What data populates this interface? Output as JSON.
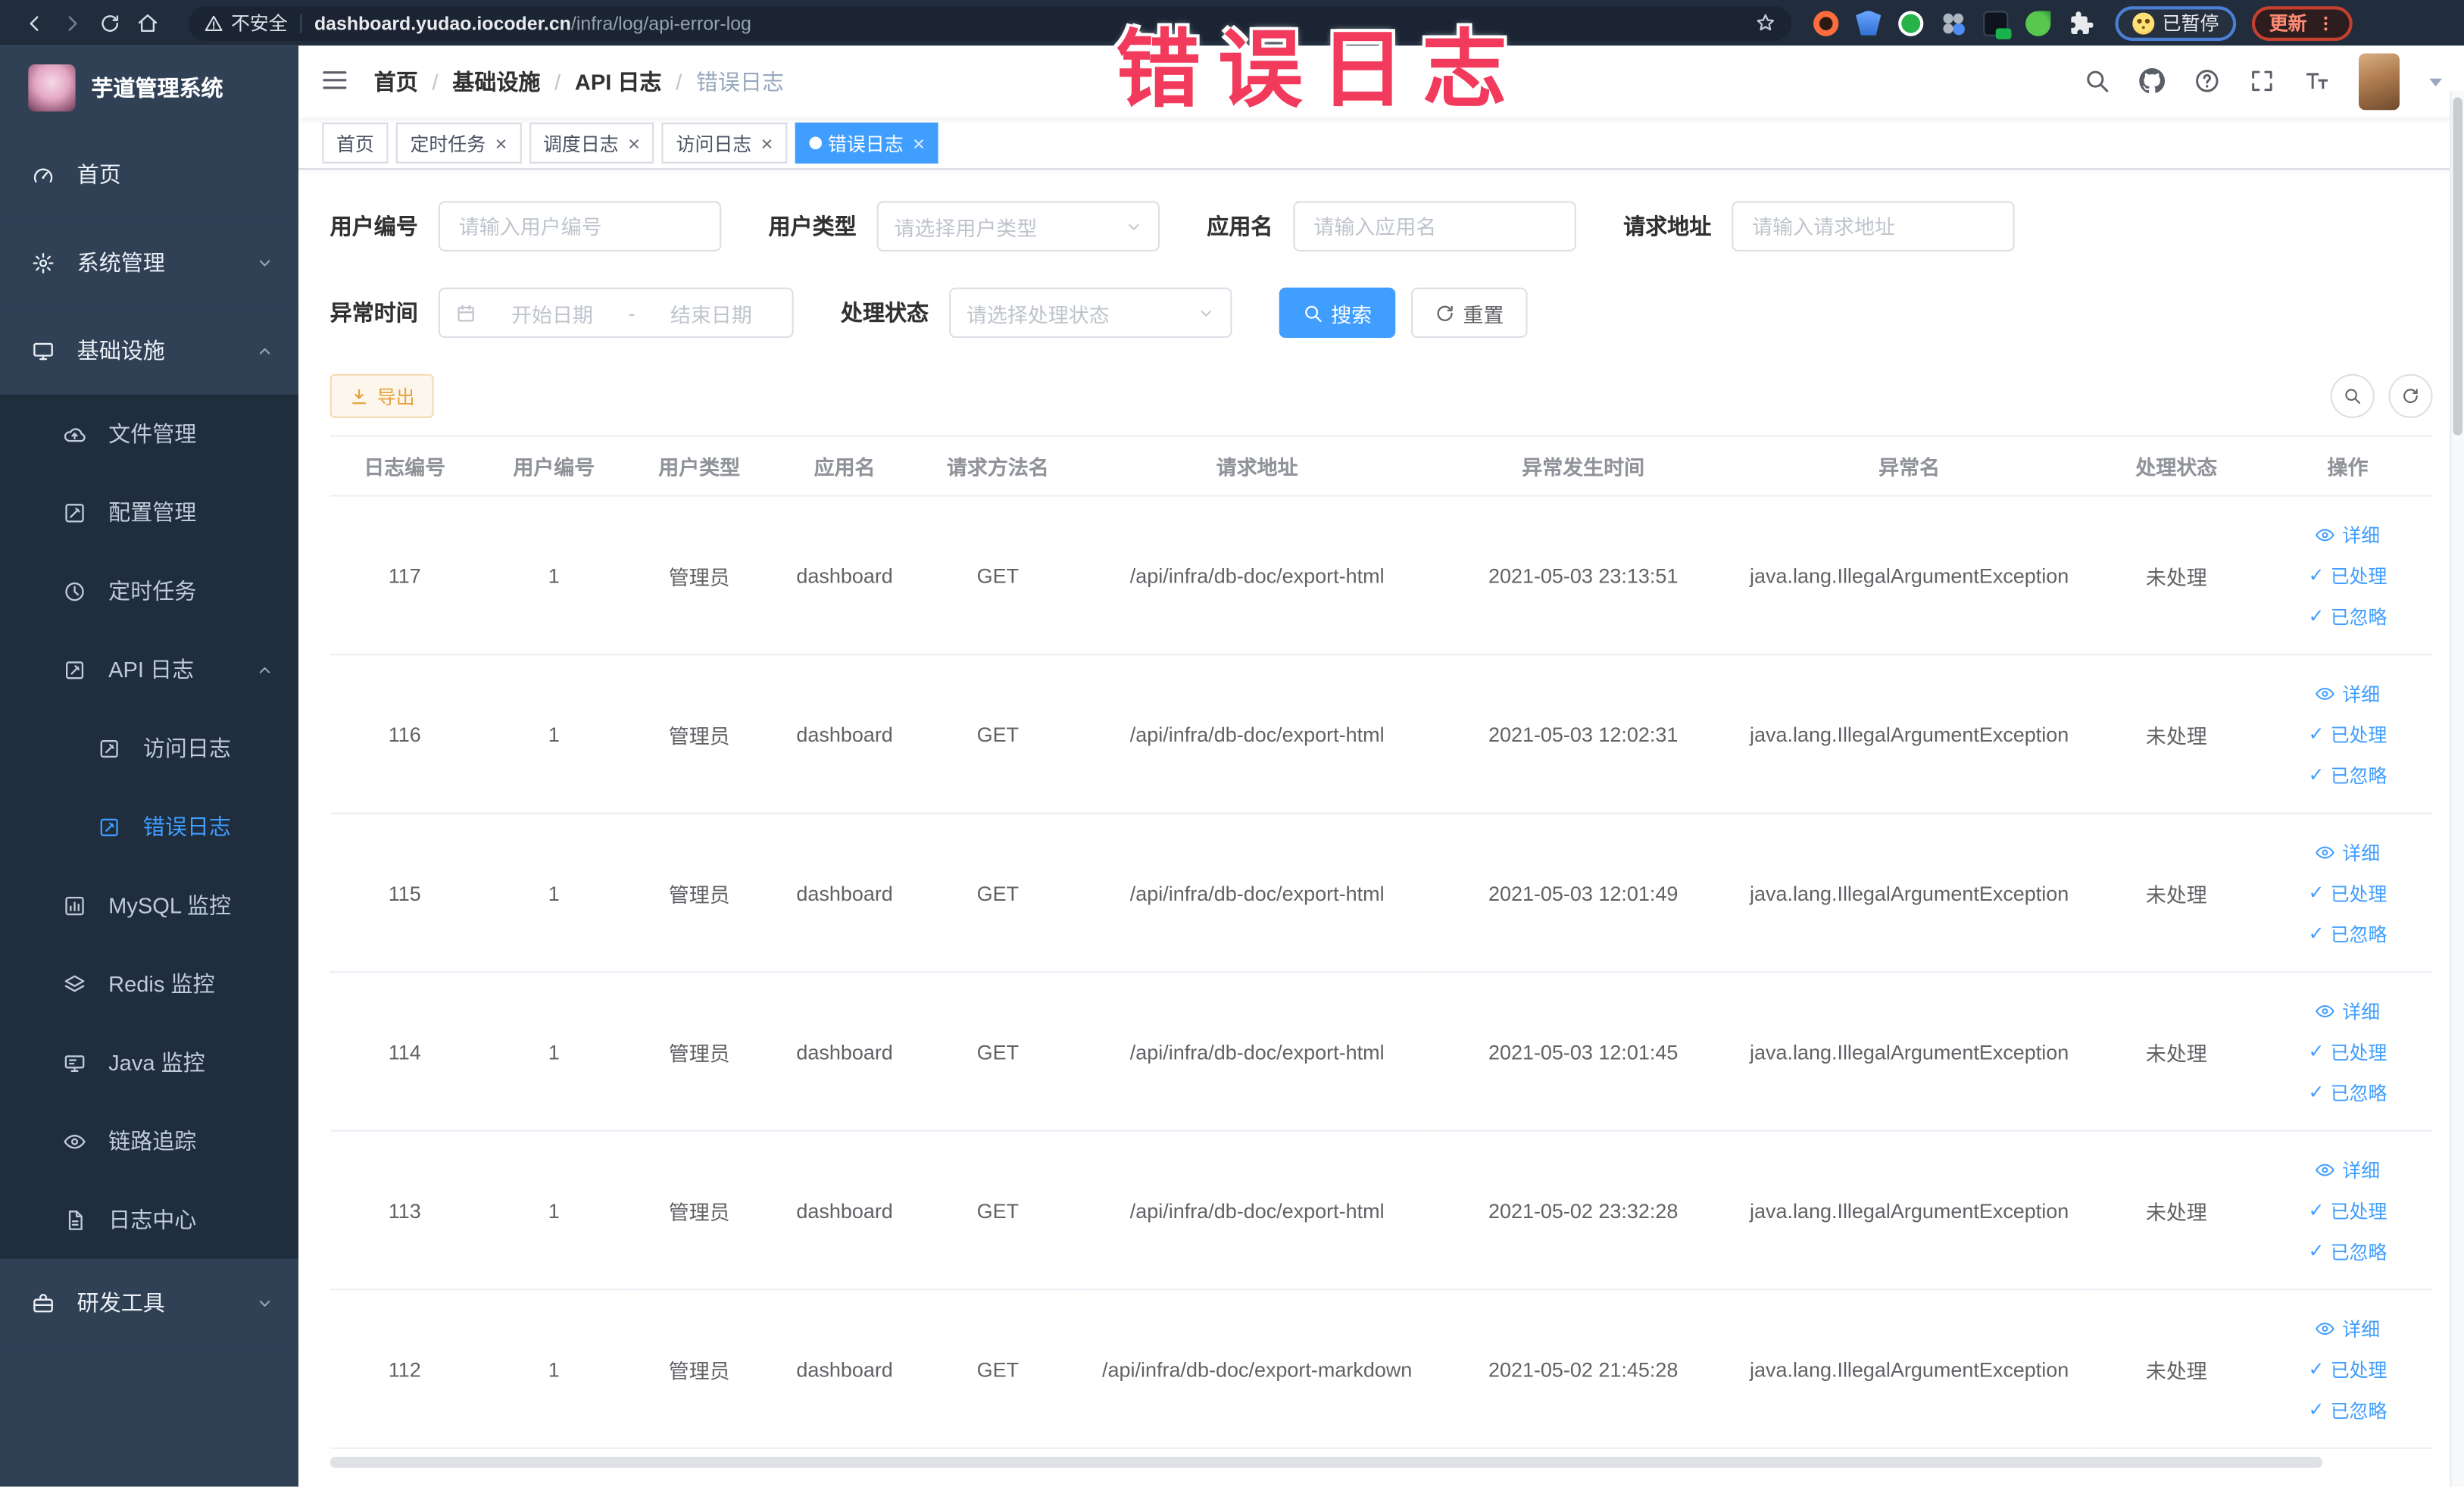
{
  "browser": {
    "security_label": "不安全",
    "url_host": "dashboard.yudao.iocoder.cn",
    "url_path": "/infra/log/api-error-log",
    "paused_label": "已暂停",
    "update_label": "更新"
  },
  "overlay": {
    "title": "错误日志"
  },
  "sidebar": {
    "app_title": "芋道管理系统",
    "items": [
      {
        "name": "home",
        "label": "首页",
        "icon": "gauge",
        "type": "top"
      },
      {
        "name": "system-management",
        "label": "系统管理",
        "icon": "gear",
        "type": "top",
        "arrow": "down"
      },
      {
        "name": "infrastructure",
        "label": "基础设施",
        "icon": "screen",
        "type": "top",
        "arrow": "up"
      },
      {
        "name": "file-management",
        "label": "文件管理",
        "icon": "cloud",
        "type": "sub"
      },
      {
        "name": "config-management",
        "label": "配置管理",
        "icon": "edit",
        "type": "sub"
      },
      {
        "name": "scheduled-tasks",
        "label": "定时任务",
        "icon": "clock",
        "type": "sub"
      },
      {
        "name": "api-log",
        "label": "API 日志",
        "icon": "docedit",
        "type": "sub",
        "arrow": "up"
      },
      {
        "name": "access-log",
        "label": "访问日志",
        "icon": "docedit",
        "type": "sub2"
      },
      {
        "name": "error-log",
        "label": "错误日志",
        "icon": "docedit",
        "type": "sub2",
        "active": true
      },
      {
        "name": "mysql-monitor",
        "label": "MySQL 监控",
        "icon": "chart",
        "type": "sub"
      },
      {
        "name": "redis-monitor",
        "label": "Redis 监控",
        "icon": "layers",
        "type": "sub"
      },
      {
        "name": "java-monitor",
        "label": "Java 监控",
        "icon": "monitor",
        "type": "sub"
      },
      {
        "name": "trace",
        "label": "链路追踪",
        "icon": "eye",
        "type": "sub"
      },
      {
        "name": "log-center",
        "label": "日志中心",
        "icon": "doc",
        "type": "sub"
      },
      {
        "name": "dev-tools",
        "label": "研发工具",
        "icon": "toolbox",
        "type": "top",
        "arrow": "down"
      }
    ]
  },
  "navbar": {
    "breadcrumb": [
      {
        "name": "home",
        "label": "首页"
      },
      {
        "name": "infrastructure",
        "label": "基础设施"
      },
      {
        "name": "api-log",
        "label": "API 日志"
      },
      {
        "name": "error-log",
        "label": "错误日志",
        "current": true
      }
    ]
  },
  "tags": [
    {
      "name": "home",
      "label": "首页"
    },
    {
      "name": "scheduled-tasks",
      "label": "定时任务",
      "closable": true
    },
    {
      "name": "schedule-log",
      "label": "调度日志",
      "closable": true
    },
    {
      "name": "access-log",
      "label": "访问日志",
      "closable": true
    },
    {
      "name": "error-log",
      "label": "错误日志",
      "closable": true,
      "active": true
    }
  ],
  "filters": {
    "user_id": {
      "label": "用户编号",
      "placeholder": "请输入用户编号"
    },
    "user_type": {
      "label": "用户类型",
      "placeholder": "请选择用户类型"
    },
    "app_name": {
      "label": "应用名",
      "placeholder": "请输入应用名"
    },
    "request_url": {
      "label": "请求地址",
      "placeholder": "请输入请求地址"
    },
    "exception_time": {
      "label": "异常时间",
      "start_placeholder": "开始日期",
      "end_placeholder": "结束日期",
      "separator": "-"
    },
    "process_status": {
      "label": "处理状态",
      "placeholder": "请选择处理状态"
    },
    "search_label": "搜索",
    "reset_label": "重置",
    "export_label": "导出"
  },
  "table": {
    "columns": [
      {
        "key": "id",
        "label": "日志编号"
      },
      {
        "key": "user_id",
        "label": "用户编号"
      },
      {
        "key": "user_type",
        "label": "用户类型"
      },
      {
        "key": "app",
        "label": "应用名"
      },
      {
        "key": "method",
        "label": "请求方法名"
      },
      {
        "key": "url",
        "label": "请求地址"
      },
      {
        "key": "time",
        "label": "异常发生时间"
      },
      {
        "key": "exception",
        "label": "异常名"
      },
      {
        "key": "status",
        "label": "处理状态"
      },
      {
        "key": "ops",
        "label": "操作"
      }
    ],
    "actions": [
      {
        "name": "detail",
        "label": "详细",
        "icon": "eye"
      },
      {
        "name": "processed",
        "label": "已处理",
        "icon": "check"
      },
      {
        "name": "ignored",
        "label": "已忽略",
        "icon": "check"
      }
    ],
    "rows": [
      {
        "id": "117",
        "user_id": "1",
        "user_type": "管理员",
        "app": "dashboard",
        "method": "GET",
        "url": "/api/infra/db-doc/export-html",
        "time": "2021-05-03 23:13:51",
        "exception": "java.lang.IllegalArgumentException",
        "status": "未处理"
      },
      {
        "id": "116",
        "user_id": "1",
        "user_type": "管理员",
        "app": "dashboard",
        "method": "GET",
        "url": "/api/infra/db-doc/export-html",
        "time": "2021-05-03 12:02:31",
        "exception": "java.lang.IllegalArgumentException",
        "status": "未处理"
      },
      {
        "id": "115",
        "user_id": "1",
        "user_type": "管理员",
        "app": "dashboard",
        "method": "GET",
        "url": "/api/infra/db-doc/export-html",
        "time": "2021-05-03 12:01:49",
        "exception": "java.lang.IllegalArgumentException",
        "status": "未处理"
      },
      {
        "id": "114",
        "user_id": "1",
        "user_type": "管理员",
        "app": "dashboard",
        "method": "GET",
        "url": "/api/infra/db-doc/export-html",
        "time": "2021-05-03 12:01:45",
        "exception": "java.lang.IllegalArgumentException",
        "status": "未处理"
      },
      {
        "id": "113",
        "user_id": "1",
        "user_type": "管理员",
        "app": "dashboard",
        "method": "GET",
        "url": "/api/infra/db-doc/export-html",
        "time": "2021-05-02 23:32:28",
        "exception": "java.lang.IllegalArgumentException",
        "status": "未处理"
      },
      {
        "id": "112",
        "user_id": "1",
        "user_type": "管理员",
        "app": "dashboard",
        "method": "GET",
        "url": "/api/infra/db-doc/export-markdown",
        "time": "2021-05-02 21:45:28",
        "exception": "java.lang.IllegalArgumentException",
        "status": "未处理"
      }
    ]
  },
  "glyphs": {
    "close": "×",
    "check": "✓",
    "slash": "/"
  },
  "colors": {
    "primary": "#409EFF",
    "sidebar_bg": "#304156",
    "submenu_bg": "#1f2d3d",
    "overlay": "#f23a5c",
    "export": "#e6a23c"
  }
}
